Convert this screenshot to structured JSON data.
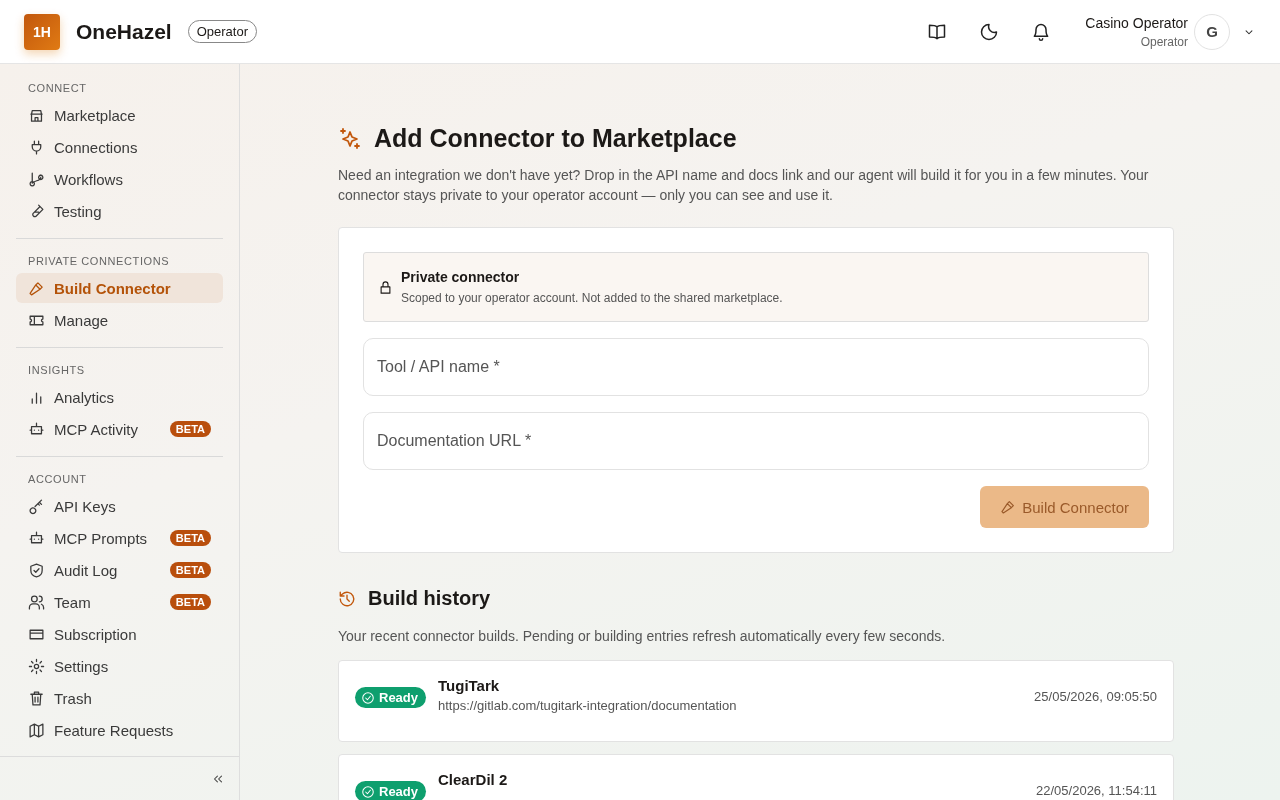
{
  "header": {
    "logo": "1H",
    "brand": "OneHazel",
    "role_badge": "Operator",
    "user": {
      "name": "Casino Operator",
      "role": "Operator",
      "avatar": "G"
    }
  },
  "sidebar": {
    "sections": [
      {
        "title": "CONNECT",
        "items": [
          {
            "label": "Marketplace",
            "selected": false
          },
          {
            "label": "Connections",
            "selected": false
          },
          {
            "label": "Workflows",
            "selected": false
          },
          {
            "label": "Testing",
            "selected": false
          }
        ]
      },
      {
        "title": "PRIVATE CONNECTIONS",
        "items": [
          {
            "label": "Build Connector",
            "selected": true
          },
          {
            "label": "Manage",
            "selected": false
          }
        ]
      },
      {
        "title": "INSIGHTS",
        "items": [
          {
            "label": "Analytics",
            "selected": false
          },
          {
            "label": "MCP Activity",
            "selected": false,
            "badge": "BETA"
          }
        ]
      },
      {
        "title": "ACCOUNT",
        "items": [
          {
            "label": "API Keys",
            "selected": false
          },
          {
            "label": "MCP Prompts",
            "selected": false,
            "badge": "BETA"
          },
          {
            "label": "Audit Log",
            "selected": false,
            "badge": "BETA"
          },
          {
            "label": "Team",
            "selected": false,
            "badge": "BETA"
          },
          {
            "label": "Subscription",
            "selected": false
          },
          {
            "label": "Settings",
            "selected": false
          },
          {
            "label": "Trash",
            "selected": false
          },
          {
            "label": "Feature Requests",
            "selected": false
          }
        ]
      }
    ]
  },
  "page": {
    "title": "Add Connector to Marketplace",
    "description": "Need an integration we don't have yet? Drop in the API name and docs link and our agent will build it for you in a few minutes. Your connector stays private to your operator account — only you can see and use it.",
    "notice": {
      "title": "Private connector",
      "text": "Scoped to your operator account. Not added to the shared marketplace."
    },
    "fields": [
      {
        "placeholder": "Tool / API name *"
      },
      {
        "placeholder": "Documentation URL *"
      }
    ],
    "submit": {
      "label": "Build Connector",
      "disabled": true
    }
  },
  "history": {
    "title": "Build history",
    "description": "Your recent connector builds. Pending or building entries refresh automatically every few seconds.",
    "rows": [
      {
        "status": "Ready",
        "kind": "ready",
        "name": "TugiTark",
        "url": "https://gitlab.com/tugitark-integration/documentation",
        "time": "25/05/2026, 09:05:50"
      },
      {
        "status": "Ready",
        "kind": "ready",
        "name": "ClearDil 2",
        "time": "22/05/2026, 11:54:11"
      }
    ]
  }
}
